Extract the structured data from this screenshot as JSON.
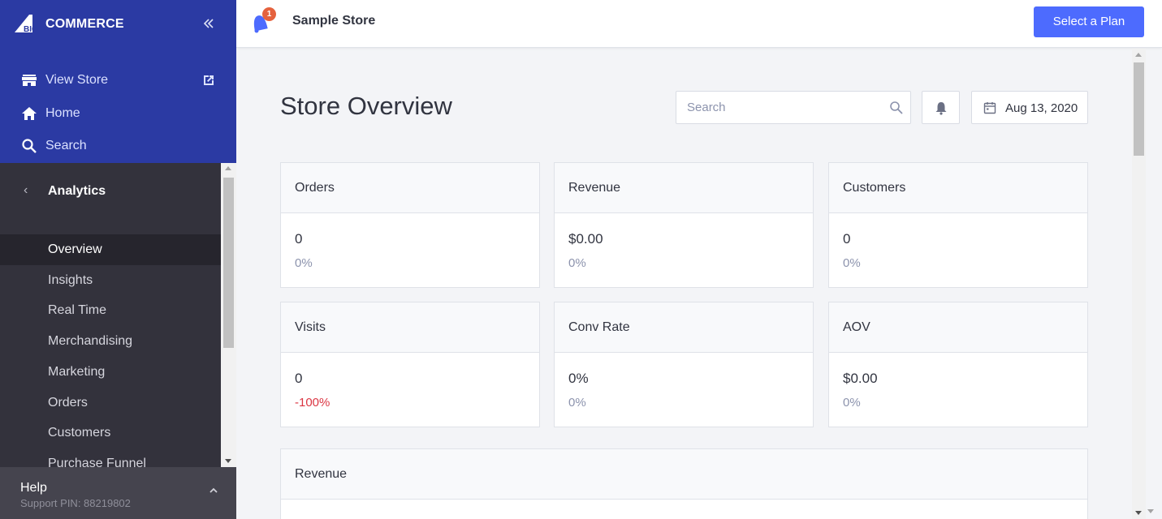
{
  "brand": {
    "logo_text": "BIGCOMMERCE",
    "logo_text_after_mark": "COMMERCE",
    "logo_mark_text": "BIG",
    "colors": {
      "sidebar_top": "#2b3aa3",
      "sidebar": "#33323c",
      "accent_button": "#4d6bfe",
      "badge": "#e5623e",
      "negative": "#db3643"
    }
  },
  "sidebar": {
    "collapse_icon": "double-chevron-left-icon",
    "top_items": [
      {
        "label": "View Store",
        "icon": "storefront-icon",
        "trailing_icon": "external-link-icon"
      },
      {
        "label": "Home",
        "icon": "home-icon"
      },
      {
        "label": "Search",
        "icon": "search-icon"
      }
    ],
    "section": {
      "label": "Analytics",
      "icon": "chevron-left-icon"
    },
    "sub_items": [
      {
        "label": "Overview",
        "active": true
      },
      {
        "label": "Insights",
        "active": false
      },
      {
        "label": "Real Time",
        "active": false
      },
      {
        "label": "Merchandising",
        "active": false
      },
      {
        "label": "Marketing",
        "active": false
      },
      {
        "label": "Orders",
        "active": false
      },
      {
        "label": "Customers",
        "active": false
      },
      {
        "label": "Purchase Funnel",
        "active": false
      }
    ],
    "help": {
      "label": "Help",
      "support_pin": "Support PIN: 88219802",
      "icon": "chevron-up-icon"
    }
  },
  "header": {
    "notification_badge": "1",
    "store_name": "Sample Store",
    "select_plan_label": "Select a Plan"
  },
  "main": {
    "title": "Store Overview",
    "search_placeholder": "Search",
    "date_label": "Aug 13, 2020",
    "cards": [
      {
        "title": "Orders",
        "value": "0",
        "change": "0%",
        "negative": false
      },
      {
        "title": "Revenue",
        "value": "$0.00",
        "change": "0%",
        "negative": false
      },
      {
        "title": "Customers",
        "value": "0",
        "change": "0%",
        "negative": false
      },
      {
        "title": "Visits",
        "value": "0",
        "change": "-100%",
        "negative": true
      },
      {
        "title": "Conv Rate",
        "value": "0%",
        "change": "0%",
        "negative": false
      },
      {
        "title": "AOV",
        "value": "$0.00",
        "change": "0%",
        "negative": false
      }
    ],
    "revenue_section_title": "Revenue"
  }
}
